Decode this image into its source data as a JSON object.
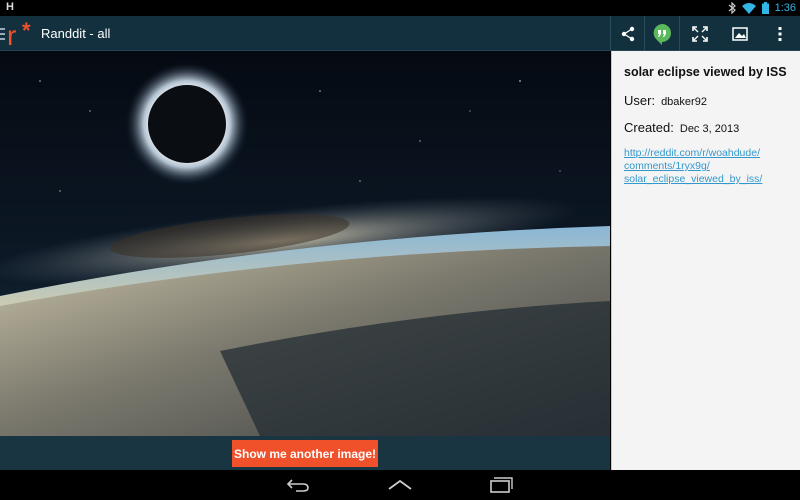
{
  "status_bar": {
    "left_icon": "H",
    "time": "1:36",
    "icons": [
      "bluetooth-icon",
      "wifi-icon",
      "battery-icon"
    ]
  },
  "action_bar": {
    "logo": "r*",
    "app_title": "Randdit - all",
    "actions": [
      "share-icon",
      "hangouts-icon",
      "fullscreen-icon",
      "gallery-icon",
      "overflow-menu-icon"
    ],
    "accent_color": "#f0502a",
    "bar_color": "#12303d"
  },
  "image": {
    "subject": "solar eclipse viewed by ISS"
  },
  "button": {
    "show_another": "Show me another image!"
  },
  "post": {
    "title": "solar eclipse viewed by ISS",
    "user_label": "User:",
    "user": "dbaker92",
    "created_label": "Created:",
    "created": "Dec 3, 2013",
    "link_lines": [
      "http://reddit.com/r/woahdude/",
      "comments/1ryx9g/",
      "solar_eclipse_viewed_by_iss/"
    ]
  },
  "nav_bar": {
    "buttons": [
      "back-icon",
      "home-icon",
      "recents-icon"
    ]
  }
}
